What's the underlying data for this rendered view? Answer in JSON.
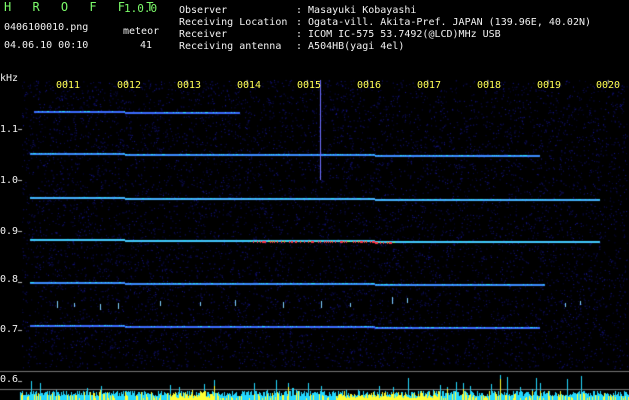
{
  "header": {
    "app_name": "H R O F F T",
    "version": "1.0.0",
    "file_name": "0406100010.png",
    "date_time": "04.06.10 00:10",
    "meteor_label": "meteor",
    "meteor_count": "41"
  },
  "info": {
    "rows": [
      {
        "label": "Observer",
        "value": ": Masayuki Kobayashi"
      },
      {
        "label": "Receiving Location",
        "value": ": Ogata-vill. Akita-Pref. JAPAN (139.96E, 40.02N)"
      },
      {
        "label": "Receiver",
        "value": ": ICOM IC-575 53.7492(@LCD)MHz USB"
      },
      {
        "label": "Receiving antenna",
        "value": ": A504HB(yagi 4el)"
      }
    ]
  },
  "axes": {
    "y_unit": "kHz",
    "y_ticks": [
      "1.1",
      "1.0",
      "0.9",
      "0.8",
      "0.7",
      "0.6"
    ],
    "x_ticks": [
      "0011",
      "0012",
      "0013",
      "0014",
      "0015",
      "0016",
      "0017",
      "0018",
      "0019",
      "0020"
    ]
  },
  "colors": {
    "background": "#000000",
    "noise": "#16167a",
    "trace_blue": "#3b6cff",
    "trace_cyan": "#33e0ff",
    "trace_hot": "#ff3344",
    "bar_cyan": "#22d8ff",
    "bar_yellow": "#ffff33",
    "header_green": "#7CFC6A"
  }
}
